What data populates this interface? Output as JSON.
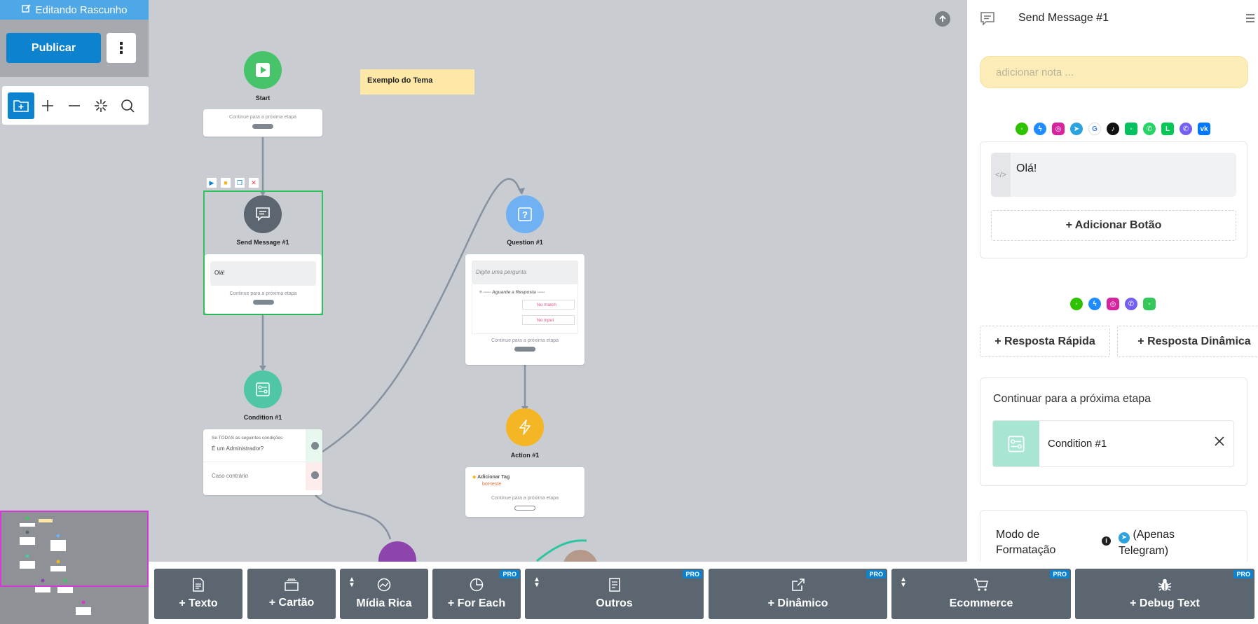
{
  "sidebar": {
    "draft_label": "Editando Rascunho",
    "publish_label": "Publicar",
    "more_label": "⋮"
  },
  "canvas": {
    "note_text": "Exemplo do Tema",
    "continue_text": "Continue para a próxima etapa",
    "nodes": {
      "start": {
        "title": "Start"
      },
      "send_message": {
        "title": "Send Message #1",
        "text": "Olá!"
      },
      "condition": {
        "title": "Condition #1",
        "rule_header": "Se TODAS as seguintes condições",
        "rule_value": "É um Administrador?",
        "else_label": "Caso contrário"
      },
      "question": {
        "title": "Question #1",
        "placeholder": "Digite uma pergunta",
        "await_label": "Aguarde a Resposta",
        "no_match": "No match",
        "no_input": "No input"
      },
      "action": {
        "title": "Action #1",
        "action_label": "Adicionar Tag",
        "tag_value": "bot-teste"
      }
    }
  },
  "panel": {
    "title": "Send Message #1",
    "note_placeholder": "adicionar nota ...",
    "message_text": "Olá!",
    "add_button_label": "+ Adicionar Botão",
    "quick_reply_label": "+ Resposta Rápida",
    "dynamic_reply_label": "+ Resposta Dinâmica",
    "next_step_label": "Continuar para a próxima etapa",
    "next_step_target": "Condition #1",
    "format_label": "Modo de Formatação",
    "format_telegram": "(Apenas Telegram)",
    "platform_icons_1": [
      "wechat-icon",
      "messenger-icon",
      "instagram-icon",
      "telegram-icon",
      "google-icon",
      "tiktok-icon",
      "wecom-icon",
      "whatsapp-icon",
      "line-icon",
      "viber-icon",
      "vk-icon"
    ],
    "platform_icons_2": [
      "wechat-icon",
      "messenger-icon",
      "instagram-icon",
      "viber-icon",
      "imessage-icon"
    ]
  },
  "toolbar": {
    "items": [
      {
        "label": "+ Texto",
        "icon": "document-icon",
        "pro": false
      },
      {
        "label": "+ Cartão",
        "icon": "card-icon",
        "pro": false
      },
      {
        "label": "Mídia Rica",
        "icon": "media-icon",
        "pro": false
      },
      {
        "label": "+ For Each",
        "icon": "pie-icon",
        "pro": true
      },
      {
        "label": "Outros",
        "icon": "list-icon",
        "pro": true
      },
      {
        "label": "+ Dinâmico",
        "icon": "external-link-icon",
        "pro": true
      },
      {
        "label": "Ecommerce",
        "icon": "cart-icon",
        "pro": true
      },
      {
        "label": "+ Debug Text",
        "icon": "bug-icon",
        "pro": true
      }
    ],
    "pro_badge": "PRO"
  },
  "colors": {
    "primary": "#0d83d0",
    "start_node": "#47c46a",
    "message_node": "#5c6670",
    "condition_node": "#4fc6a6",
    "question_node": "#6fb1f2",
    "action_node": "#f5b625",
    "selection": "#2ec55e"
  }
}
